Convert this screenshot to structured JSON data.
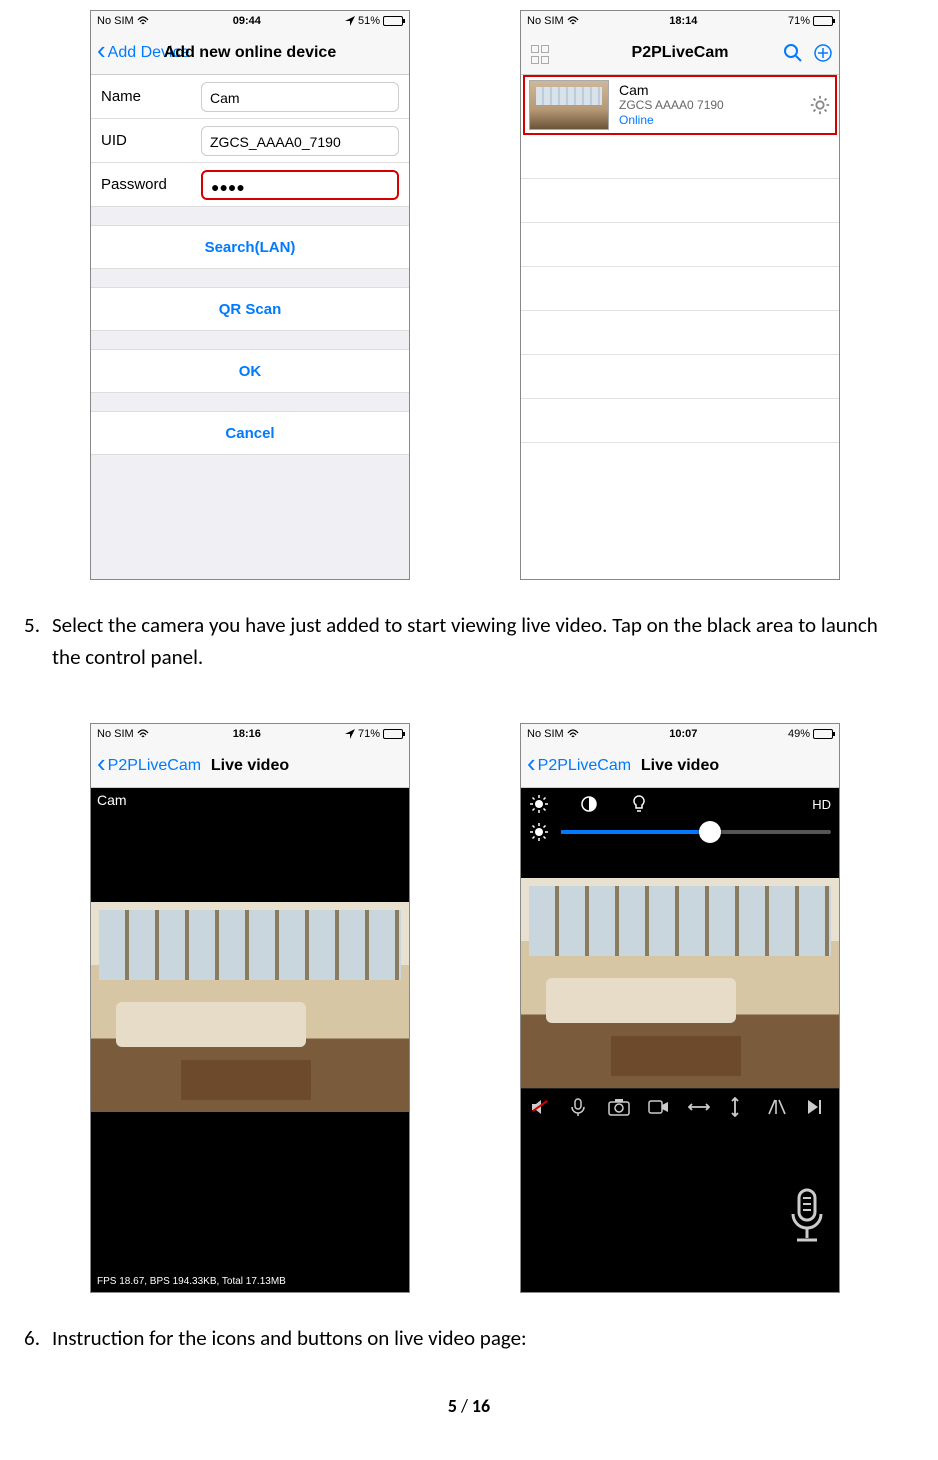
{
  "screen_add": {
    "statusbar": {
      "carrier": "No SIM",
      "time": "09:44",
      "battery": "51%",
      "battery_fill": 51
    },
    "nav": {
      "back": "Add Device",
      "title": "Add new online device"
    },
    "fields": {
      "name_label": "Name",
      "name_value": "Cam",
      "uid_label": "UID",
      "uid_value": "ZGCS_AAAA0_7190",
      "pwd_label": "Password",
      "pwd_value": "●●●●"
    },
    "buttons": {
      "search": "Search(LAN)",
      "qr": "QR Scan",
      "ok": "OK",
      "cancel": "Cancel"
    }
  },
  "screen_list": {
    "statusbar": {
      "carrier": "No SIM",
      "time": "18:14",
      "battery": "71%",
      "battery_fill": 71
    },
    "nav": {
      "title": "P2PLiveCam"
    },
    "device": {
      "name": "Cam",
      "uid": "ZGCS  AAAA0  7190",
      "status": "Online"
    }
  },
  "instruction5": {
    "num": "5.",
    "text": "Select the camera you have just added to start viewing live video. Tap on the black area to launch the control panel."
  },
  "screen_live1": {
    "statusbar": {
      "carrier": "No SIM",
      "time": "18:16",
      "battery": "71%",
      "battery_fill": 71
    },
    "nav": {
      "back": "P2PLiveCam",
      "title": "Live video"
    },
    "cam_name": "Cam",
    "stats": "FPS 18.67, BPS 194.33KB, Total 17.13MB"
  },
  "screen_live2": {
    "statusbar": {
      "carrier": "No SIM",
      "time": "10:07",
      "battery": "49%",
      "battery_fill": 49
    },
    "nav": {
      "back": "P2PLiveCam",
      "title": "Live video"
    },
    "hd_label": "HD",
    "slider_pct": 55
  },
  "instruction6": {
    "num": "6.",
    "text": "Instruction for the icons and buttons on live video page:"
  },
  "footer": {
    "current": "5",
    "sep": "/",
    "total": "16"
  }
}
